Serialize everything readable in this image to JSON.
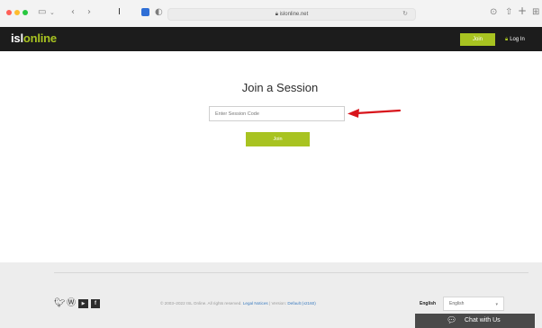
{
  "browser": {
    "url": "islonline.net",
    "colors": {
      "red": "#ff5f57",
      "yellow": "#febc2e",
      "green": "#28c840"
    }
  },
  "header": {
    "logo_prefix": "isl",
    "logo_suffix": "online",
    "join_label": "Join",
    "login_label": "Log In",
    "accent_color": "#a8c321"
  },
  "main": {
    "title": "Join a Session",
    "session_input": {
      "value": "",
      "placeholder": "Enter Session Code"
    },
    "join_label": "Join"
  },
  "footer": {
    "social_icons": [
      "twitter-icon",
      "wordpress-icon",
      "youtube-icon",
      "facebook-icon"
    ],
    "copyright_text": "© 2003–2022 ISL Online. All rights reserved.",
    "legal_link": "Legal Notices",
    "version_label": "Version:",
    "version_link": "Default (v2160)",
    "language_label": "English",
    "language_selected": "English",
    "chat_label": "Chat with Us"
  }
}
